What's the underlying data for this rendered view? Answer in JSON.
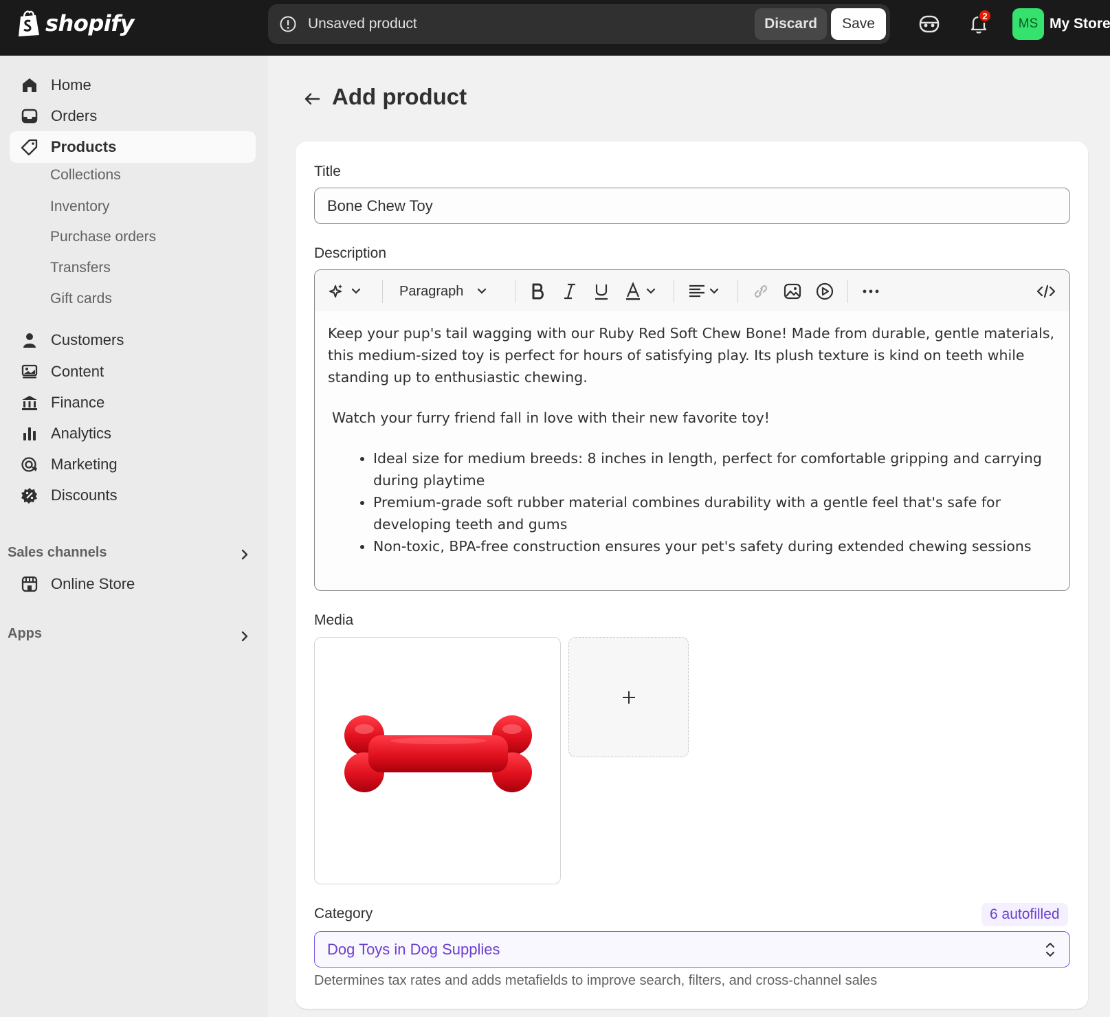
{
  "brand": {
    "logo_text": "shopify"
  },
  "savebar": {
    "message": "Unsaved product",
    "discard_label": "Discard",
    "save_label": "Save"
  },
  "header": {
    "notifications_count": "2",
    "avatar_initials": "MS",
    "store_name": "My Store"
  },
  "sidebar": {
    "items": [
      {
        "label": "Home",
        "icon": "home-icon"
      },
      {
        "label": "Orders",
        "icon": "orders-icon"
      },
      {
        "label": "Products",
        "icon": "tag-icon",
        "active": true
      },
      {
        "label": "Customers",
        "icon": "person-icon"
      },
      {
        "label": "Content",
        "icon": "content-icon"
      },
      {
        "label": "Finance",
        "icon": "bank-icon"
      },
      {
        "label": "Analytics",
        "icon": "bar-chart-icon"
      },
      {
        "label": "Marketing",
        "icon": "target-icon"
      },
      {
        "label": "Discounts",
        "icon": "discount-icon"
      }
    ],
    "product_subitems": [
      "Collections",
      "Inventory",
      "Purchase orders",
      "Transfers",
      "Gift cards"
    ],
    "sales_channels_title": "Sales channels",
    "online_store_label": "Online Store",
    "apps_title": "Apps"
  },
  "page": {
    "title": "Add product"
  },
  "form": {
    "title_label": "Title",
    "title_value": "Bone Chew Toy",
    "description_label": "Description",
    "toolbar": {
      "paragraph_label": "Paragraph"
    },
    "description": {
      "p1": "Keep your pup's tail wagging with our Ruby Red Soft Chew Bone! Made from durable, gentle materials, this medium-sized toy is perfect for hours of satisfying play. Its plush texture is kind on teeth while standing up to enthusiastic chewing.",
      "p2": "Watch your furry friend fall in love with their new favorite toy!",
      "bullets": [
        "Ideal size for medium breeds: 8 inches in length, perfect for comfortable gripping and carrying during playtime",
        "Premium-grade soft rubber material combines durability with a gentle feel that's safe for developing teeth and gums",
        "Non-toxic, BPA-free construction ensures your pet's safety during extended chewing sessions"
      ]
    },
    "media_label": "Media",
    "category_label": "Category",
    "category_badge": "6 autofilled",
    "category_value": "Dog Toys in Dog Supplies",
    "category_helper": "Determines tax rates and adds metafields to improve search, filters, and cross-channel sales"
  },
  "colors": {
    "topbar": "#1a1a1a",
    "accent_purple": "#6a3fcf",
    "avatar_green": "#36e26e",
    "product_red": "#e0101e"
  }
}
